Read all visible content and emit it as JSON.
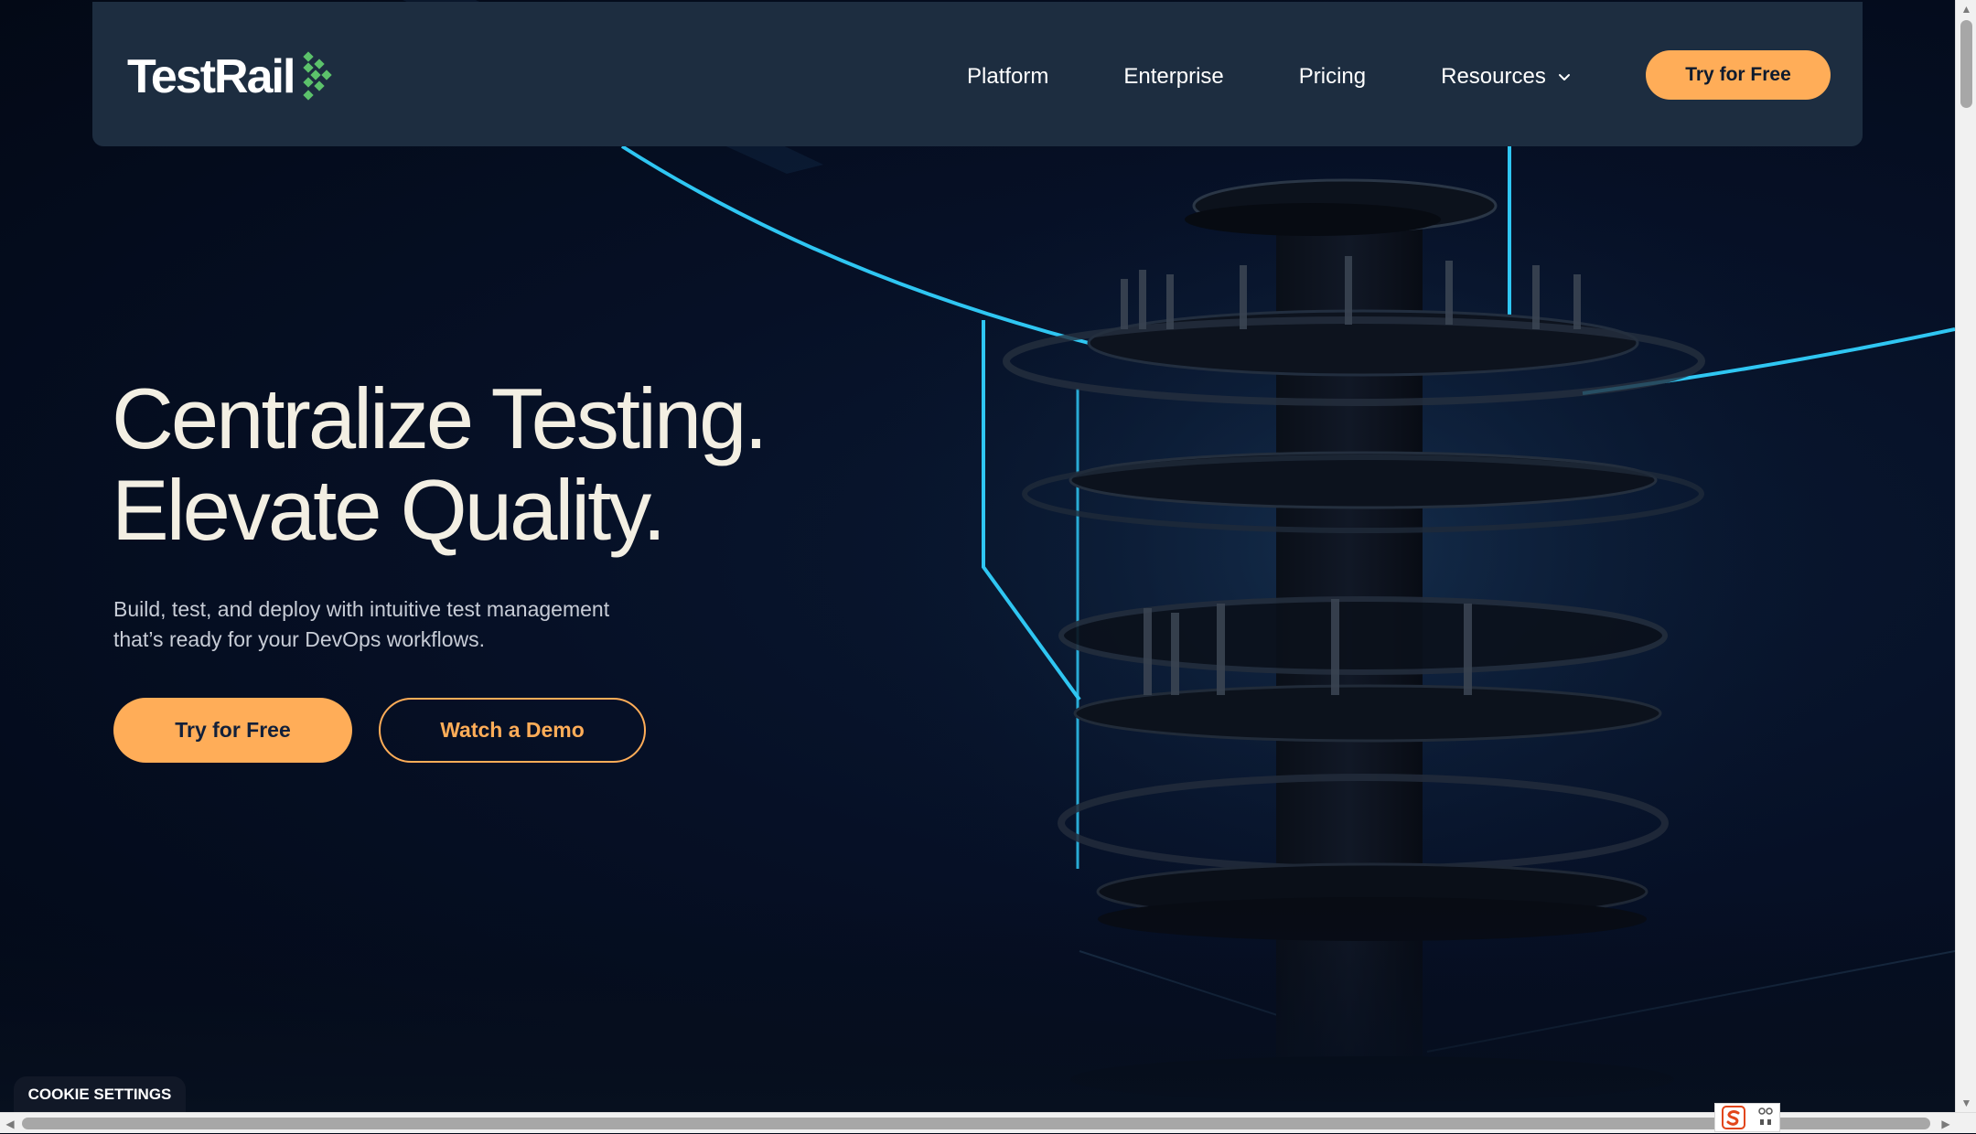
{
  "brand": {
    "name": "TestRail",
    "accent": "#ffad58",
    "logo_mark_color": "#5cc26b"
  },
  "nav": {
    "items": [
      {
        "label": "Platform"
      },
      {
        "label": "Enterprise"
      },
      {
        "label": "Pricing"
      },
      {
        "label": "Resources",
        "icon": "chevron-down-icon"
      }
    ],
    "cta_label": "Try for Free"
  },
  "hero": {
    "title_line1": "Centralize Testing.",
    "title_line2": "Elevate Quality.",
    "subtitle_line1": "Build, test, and deploy with intuitive test management",
    "subtitle_line2": "that’s ready for your DevOps workflows.",
    "primary_label": "Try for Free",
    "secondary_label": "Watch a Demo"
  },
  "cookie": {
    "label": "COOKIE SETTINGS"
  },
  "scrollbars": {
    "up": "▲",
    "down": "▼",
    "left": "◀",
    "right": "▶"
  }
}
